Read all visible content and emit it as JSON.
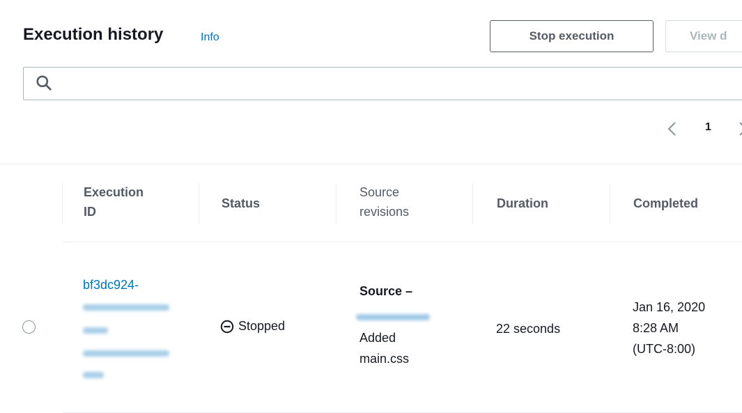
{
  "header": {
    "title": "Execution history",
    "info_label": "Info",
    "stop_button": "Stop execution",
    "view_button": "View d"
  },
  "search": {
    "value": "",
    "placeholder": ""
  },
  "pagination": {
    "current_page": "1"
  },
  "table": {
    "columns": [
      {
        "line1": "Execution",
        "line2": "ID"
      },
      {
        "line1": "Status"
      },
      {
        "line1": "Source",
        "line2": "revisions"
      },
      {
        "line1": "Duration"
      },
      {
        "line1": "Completed"
      }
    ],
    "rows": [
      {
        "execution_id_visible": "bf3dc924-",
        "status": "Stopped",
        "source_title": "Source –",
        "source_message": "Added main.css",
        "duration": "22 seconds",
        "completed_line1": "Jan 16, 2020",
        "completed_line2": "8:28 AM",
        "completed_line3": "(UTC-8:00)"
      }
    ]
  },
  "colors": {
    "link": "#0073bb",
    "text": "#16191f",
    "muted": "#545b64",
    "disabled": "#aab7b8",
    "divider": "#eaeded"
  },
  "icons": {
    "search": "search-icon",
    "prev": "chevron-left-icon",
    "next": "chevron-right-icon",
    "status": "stopped-icon"
  }
}
